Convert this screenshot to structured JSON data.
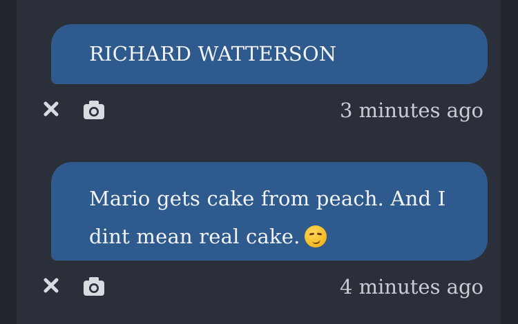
{
  "messages": [
    {
      "text": "RICHARD WATTERSON",
      "timestamp": "3 minutes ago",
      "has_emoji": false,
      "actions": [
        "close-icon",
        "camera-icon"
      ]
    },
    {
      "text_line1": "Mario gets cake from peach. And I",
      "text_line2": "dint mean real cake.",
      "emoji": "smirking-face",
      "timestamp": "4 minutes ago",
      "actions": [
        "close-icon",
        "camera-icon"
      ]
    }
  ],
  "colors": {
    "background": "#22252e",
    "panel": "#2b2f3a",
    "bubble": "#2e5a8d",
    "bubble_text": "#f2f4f7",
    "meta_text": "#c9ccd3"
  }
}
